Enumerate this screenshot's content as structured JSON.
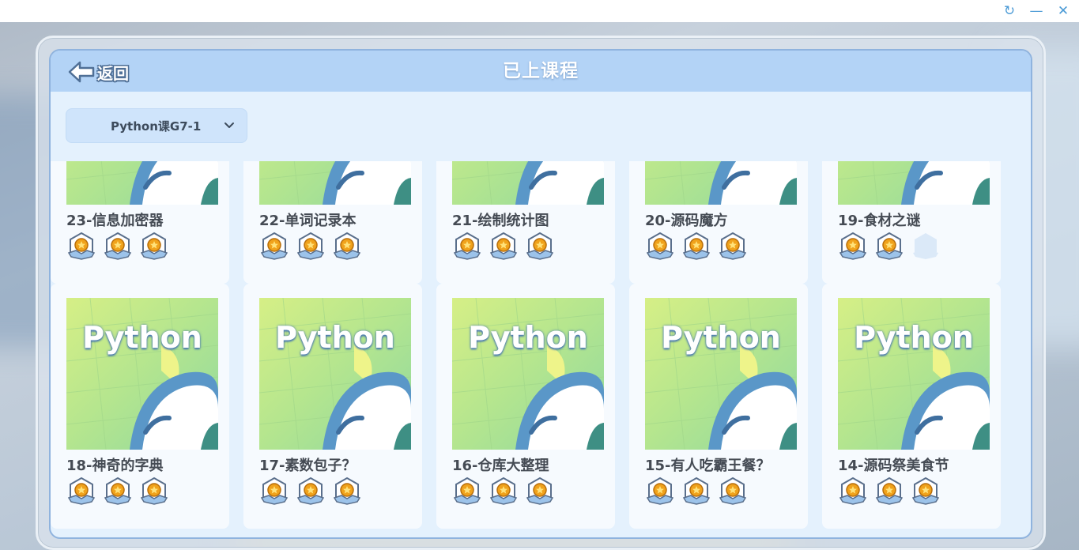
{
  "window": {
    "refresh_icon": "↻",
    "minimize_icon": "—",
    "close_icon": "✕"
  },
  "header": {
    "back_label": "返回",
    "title": "已上课程"
  },
  "course_select": {
    "selected": "Python课G7-1"
  },
  "thumbnail_text": "Python",
  "colors": {
    "header_bg": "#b3d3f6",
    "panel_bg": "#e4f1fd",
    "medal_gold": "#f0a21b",
    "accent": "#4c9bd6"
  },
  "courses_row1": [
    {
      "title": "23-信息加密器",
      "medals": 3
    },
    {
      "title": "22-单词记录本",
      "medals": 3
    },
    {
      "title": "21-绘制统计图",
      "medals": 3
    },
    {
      "title": "20-源码魔方",
      "medals": 3
    },
    {
      "title": "19-食材之谜",
      "medals": 2
    }
  ],
  "courses_row2": [
    {
      "title": "18-神奇的字典",
      "medals": 3
    },
    {
      "title": "17-素数包子？",
      "medals": 3
    },
    {
      "title": "16-仓库大整理",
      "medals": 3
    },
    {
      "title": "15-有人吃霸王餐？",
      "medals": 3
    },
    {
      "title": "14-源码祭美食节",
      "medals": 3
    }
  ],
  "medals_total": 3
}
